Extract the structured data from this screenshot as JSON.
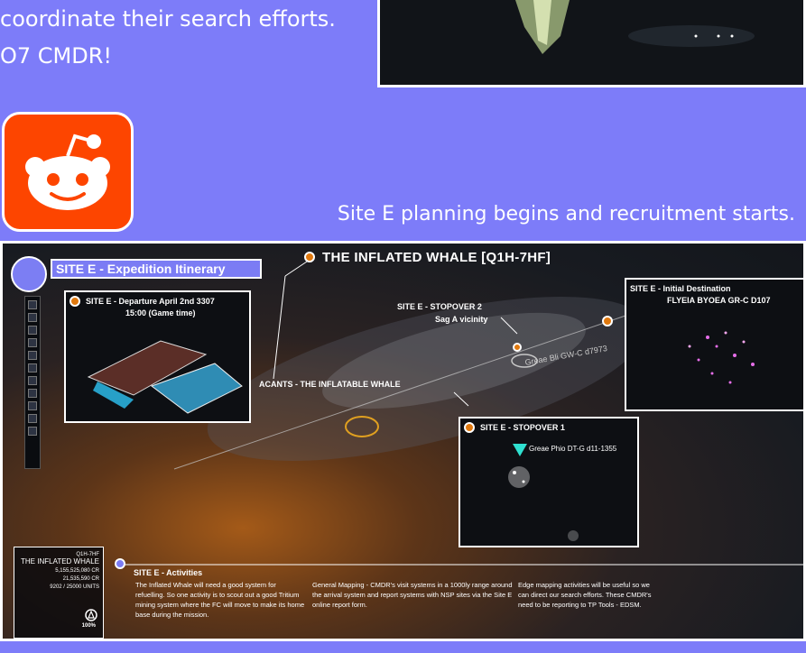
{
  "intro": {
    "line1": "coordinate their search efforts.",
    "line2": "O7 CMDR!"
  },
  "reddit": {
    "icon": "reddit-icon",
    "color": "#fd4500"
  },
  "caption": "Site E planning begins and recruitment starts.",
  "map": {
    "header": "SITE E - Expedition Itinerary",
    "title": "THE INFLATED WHALE  [Q1H-7HF]",
    "departure_title": "SITE E - Departure April 2nd 3307",
    "departure_time": "15:00 (Game time)",
    "initial_title": "SITE E - Initial Destination",
    "initial_system": "FLYEIA BYOEA GR-C D107",
    "stopover2_title": "SITE E - STOPOVER 2",
    "stopover2_sub": "Sag A vicinity",
    "stopover2_system": "Greae Bli GW-C d7973",
    "acants": "ACANTS - THE INFLATABLE WHALE",
    "stopover1_title": "SITE E - STOPOVER 1",
    "stopover1_system": "Greae Phio DT-G d11-1355",
    "stats": {
      "code": "Q1H-7HF",
      "name": "THE INFLATED WHALE",
      "cr1": "5,155,525,080 CR",
      "cr2": "21,535,590 CR",
      "units": "9202 / 25000 UNITS",
      "pct": "100%"
    },
    "activities_title": "SITE E - Activities",
    "activities": [
      "The Inflated Whale will need a good system for refuelling. So one activity is to scout out a good Tritium mining system where the FC will move to make its home base during the mission.",
      "General Mapping - CMDR's visit systems in a 1000ly range around the arrival system and report systems with NSP sites via the Site E online report form.",
      "Edge mapping activities will be useful so we can direct our search efforts. These CMDR's need to be reporting to TP Tools - EDSM."
    ]
  }
}
